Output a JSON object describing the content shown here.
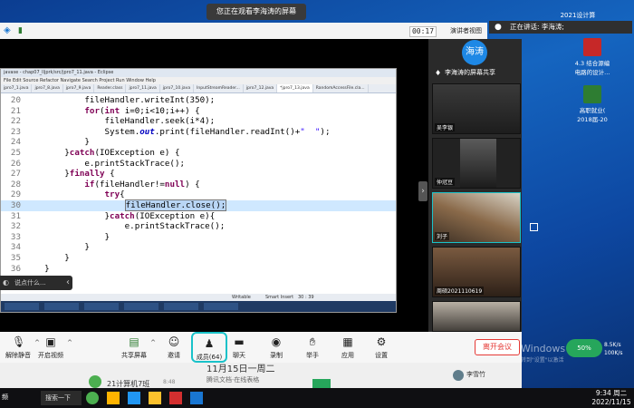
{
  "desktop": {
    "date_banner_top": "2021设计算",
    "icons": [
      {
        "label": "4.3 结合源编\n电路的设计..."
      },
      {
        "label": "高职就业(\n2018届-20"
      }
    ],
    "watermark": "Windows",
    "watermark_sub": "转到\"设置\"以激活"
  },
  "zoom": {
    "banner": "您正在观看李海涛的屏幕",
    "timer": "00:17",
    "presenter_view": "演讲者视图",
    "speaking": "正在讲话: 李海涛;",
    "toolbar": {
      "mute": "解除静音",
      "video": "开启视频",
      "share": "共享屏幕",
      "invite": "邀请",
      "participants": "成员(64)",
      "chat": "聊天",
      "record": "录制",
      "raise": "举手",
      "apps": "应用",
      "settings": "设置",
      "leave": "离开会议"
    },
    "chat_placeholder": "说点什么...",
    "panel": {
      "host_avatar": "海涛",
      "host_label": "李海涛的屏幕共享",
      "participants": [
        {
          "name": "吴李银"
        },
        {
          "name": "仲冠豆"
        },
        {
          "name": "刘子"
        },
        {
          "name": "周硕2021110619"
        },
        {
          "name": ""
        }
      ]
    }
  },
  "eclipse": {
    "title": "javase - chap07_lljprk/src/jpro7_11.java - Eclipse",
    "menu": "File  Edit  Source  Refactor  Navigate  Search  Project  Run  Window  Help",
    "tabs": [
      "jpro7_1.java",
      "jpro7_8.java",
      "jpro7_9.java",
      "Reader.class",
      "jpro7_11.java",
      "jpro7_10.java",
      "InputStreamReader...",
      "jpro7_12.java",
      "*jpro7_13.java",
      "RandomAccessFile.cla..."
    ],
    "status": {
      "mode": "Writable",
      "insert": "Smart Insert",
      "pos": "30 : 39"
    },
    "code": [
      {
        "n": "20",
        "text": "            fileHandler.writeInt(350);"
      },
      {
        "n": "21",
        "text": "            for(int i=0;i<10;i++) {"
      },
      {
        "n": "22",
        "text": "                fileHandler.seek(i*4);"
      },
      {
        "n": "23",
        "text": "                System.out.print(fileHandler.readInt()+\"  \");"
      },
      {
        "n": "24",
        "text": "            }"
      },
      {
        "n": "25",
        "text": "        }catch(IOException e) {"
      },
      {
        "n": "26",
        "text": "            e.printStackTrace();"
      },
      {
        "n": "27",
        "text": "        }finally {"
      },
      {
        "n": "28",
        "text": "            if(fileHandler!=null) {"
      },
      {
        "n": "29",
        "text": "                try{"
      },
      {
        "n": "30",
        "text": "                    fileHandler.close();"
      },
      {
        "n": "31",
        "text": "                }catch(IOException e){"
      },
      {
        "n": "32",
        "text": "                    e.printStackTrace();"
      },
      {
        "n": "33",
        "text": "                }"
      },
      {
        "n": "34",
        "text": "            }"
      },
      {
        "n": "35",
        "text": "        }"
      },
      {
        "n": "36",
        "text": "    }"
      }
    ]
  },
  "under_bar": {
    "date": "11月15日一周二",
    "doc": "腾讯文档·在线表格",
    "left_item": "21计算机7班",
    "left_time": "8:48",
    "name": "李雪竹"
  },
  "taskbar": {
    "search": "搜索一下",
    "time": "9:34 周二",
    "date": "2022/11/15",
    "net_percent": "50%",
    "net_up": "8.5K/s",
    "net_down": "100K/s",
    "left_label": "频"
  },
  "colors": {
    "accent": "#19c2c9",
    "leave": "#e53935",
    "host": "#1e88e5"
  }
}
